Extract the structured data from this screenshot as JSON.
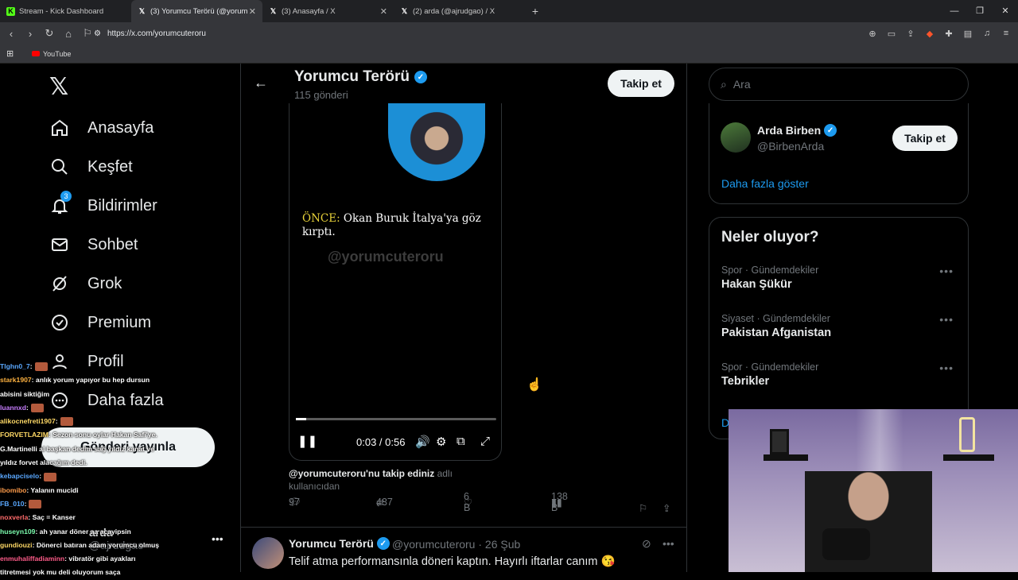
{
  "browser": {
    "tabs": [
      {
        "title": "Stream - Kick Dashboard",
        "favicon": "K",
        "color": "#53fc18",
        "active": false
      },
      {
        "title": "(3) Yorumcu Terörü (@yorum",
        "favicon": "X",
        "color": "#000000",
        "active": true
      },
      {
        "title": "(3) Anasayfa / X",
        "favicon": "X",
        "color": "#000000",
        "active": false
      },
      {
        "title": "(2) arda (@ajrudgao) / X",
        "favicon": "X",
        "color": "#000000",
        "active": false
      }
    ],
    "url": "https://x.com/yorumcuteroru",
    "bookmark": "YouTube"
  },
  "nav": {
    "items": [
      {
        "label": "Anasayfa",
        "icon": "home-icon"
      },
      {
        "label": "Keşfet",
        "icon": "search-icon"
      },
      {
        "label": "Bildirimler",
        "icon": "bell-icon",
        "badge": "3"
      },
      {
        "label": "Sohbet",
        "icon": "mail-icon"
      },
      {
        "label": "Grok",
        "icon": "grok-icon"
      },
      {
        "label": "Premium",
        "icon": "verified-icon"
      },
      {
        "label": "Profil",
        "icon": "user-icon"
      },
      {
        "label": "Daha fazla",
        "icon": "more-circle-icon"
      }
    ],
    "post_button": "Gönderi yayınla",
    "account_name": "arda",
    "account_handle": "@ajrudgao"
  },
  "chat": [
    {
      "user": "Tlghn0_7",
      "color": "#5aa8ff",
      "msg": ":",
      "emote": true
    },
    {
      "user": "stark1907",
      "color": "#ffb340",
      "msg": ": anlık yorum yapıyor bu hep dursun"
    },
    {
      "user": "",
      "color": "#ffffff",
      "msg": "abisini siktiğim"
    },
    {
      "user": "luannxd",
      "color": "#c77dff",
      "msg": ":",
      "emote": true
    },
    {
      "user": "alikocnefreti1907",
      "color": "#ffd966",
      "msg": ":",
      "emote": true
    },
    {
      "user": "FORVETLAZIM",
      "color": "#ffd966",
      "msg": ": Sezon sonu oylar Hakan Safi'ye."
    },
    {
      "user": "",
      "color": "#ffffff",
      "msg": "G.Martinelli al başkan dedim sağ yıldız kanat ve"
    },
    {
      "user": "",
      "color": "#ffffff",
      "msg": "yıldız forvet alacağım dedi."
    },
    {
      "user": "kebapciselo",
      "color": "#5aa8ff",
      "msg": ":",
      "emote": true
    },
    {
      "user": "ibomibo",
      "color": "#ff9c4a",
      "msg": ": Yalanın mucidi"
    },
    {
      "user": "FB_010",
      "color": "#5aa8ff",
      "msg": ":",
      "emote": true
    },
    {
      "user": "noxverla",
      "color": "#ff6b6b",
      "msg": ": Saç = Kanser"
    },
    {
      "user": "huseyn109",
      "color": "#7dffb0",
      "msg": ": ah yanar döner aa acayipsin"
    },
    {
      "user": "gundiouzi",
      "color": "#ffd966",
      "msg": ": Dönerci batıran adam yorumcu olmuş"
    },
    {
      "user": "enmuhaliffadiaminn",
      "color": "#ff5c8a",
      "msg": ": vibratör gibi ayakları"
    },
    {
      "user": "",
      "color": "#ffffff",
      "msg": "titretmesi yok mu deli oluyorum saça"
    }
  ],
  "profile": {
    "name": "Yorumcu Terörü",
    "post_count": "115 gönderi",
    "follow_label": "Takip et"
  },
  "video": {
    "text_highlight": "ÖNCE:",
    "text": " Okan Buruk İtalya'ya göz kırptı.",
    "watermark": "@yorumcuteroru",
    "time": "0:03 / 0:56",
    "progress": 0.05
  },
  "post": {
    "caption_handle": "@yorumcuteroru'nu takip ediniz",
    "caption_rest": " adlı kullanıcıdan",
    "replies": "97",
    "reposts": "437",
    "likes": "6 B",
    "views": "138 B"
  },
  "post2": {
    "name": "Yorumcu Terörü",
    "handle": "@yorumcuteroru · 26 Şub",
    "text": "Telif atma performansınla döneri kaptın. Hayırlı iftarlar canım 😘"
  },
  "sidebar": {
    "search_placeholder": "Ara",
    "who": {
      "name": "Arda Birben",
      "handle": "@BirbenArda",
      "follow_label": "Takip et",
      "more": "Daha fazla göster"
    },
    "trends_title": "Neler oluyor?",
    "trends": [
      {
        "category": "Spor · Gündemdekiler",
        "title": "Hakan Şükür"
      },
      {
        "category": "Siyaset · Gündemdekiler",
        "title": "Pakistan Afganistan"
      },
      {
        "category": "Spor · Gündemdekiler",
        "title": "Tebrikler"
      }
    ],
    "trends_more": "D"
  }
}
